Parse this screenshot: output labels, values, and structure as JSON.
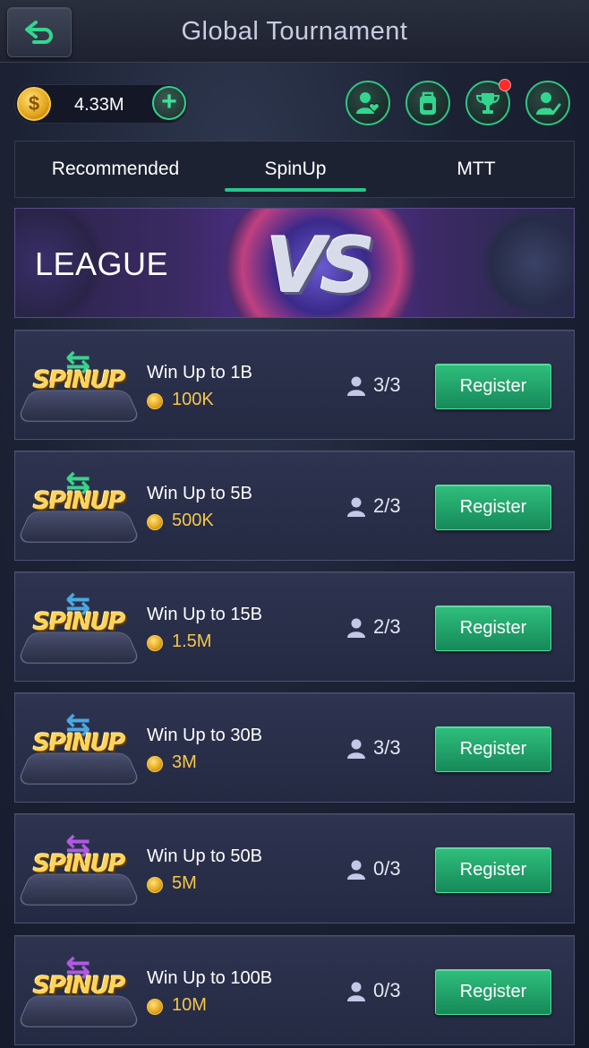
{
  "header": {
    "title": "Global Tournament",
    "back_icon": "back-arrow-icon"
  },
  "wallet": {
    "amount": "4.33M",
    "coin_symbol": "$",
    "add_symbol": "+"
  },
  "top_icons": [
    {
      "name": "friends-icon"
    },
    {
      "name": "backpack-icon"
    },
    {
      "name": "trophy-icon",
      "badge": true
    },
    {
      "name": "profile-check-icon"
    }
  ],
  "tabs": [
    {
      "label": "Recommended",
      "active": false
    },
    {
      "label": "SpinUp",
      "active": true
    },
    {
      "label": "MTT",
      "active": false
    }
  ],
  "banner": {
    "label": "LEAGUE",
    "vs_text": "VS"
  },
  "colors": {
    "accent": "#28c58a",
    "gold": "#f5c64a",
    "register_green": "#1fa36a"
  },
  "tournaments": [
    {
      "logo_text": "SPINUP",
      "title": "Win Up to 1B",
      "buy_in": "100K",
      "players": "3/3",
      "register_label": "Register",
      "arrow_color": "#3ad28c"
    },
    {
      "logo_text": "SPINUP",
      "title": "Win Up to 5B",
      "buy_in": "500K",
      "players": "2/3",
      "register_label": "Register",
      "arrow_color": "#3ad28c"
    },
    {
      "logo_text": "SPINUP",
      "title": "Win Up to 15B",
      "buy_in": "1.5M",
      "players": "2/3",
      "register_label": "Register",
      "arrow_color": "#4aa8e0"
    },
    {
      "logo_text": "SPINUP",
      "title": "Win Up to 30B",
      "buy_in": "3M",
      "players": "3/3",
      "register_label": "Register",
      "arrow_color": "#4aa8e0"
    },
    {
      "logo_text": "SPINUP",
      "title": "Win Up to 50B",
      "buy_in": "5M",
      "players": "0/3",
      "register_label": "Register",
      "arrow_color": "#b05ae0"
    },
    {
      "logo_text": "SPINUP",
      "title": "Win Up to 100B",
      "buy_in": "10M",
      "players": "0/3",
      "register_label": "Register",
      "arrow_color": "#b05ae0"
    }
  ]
}
